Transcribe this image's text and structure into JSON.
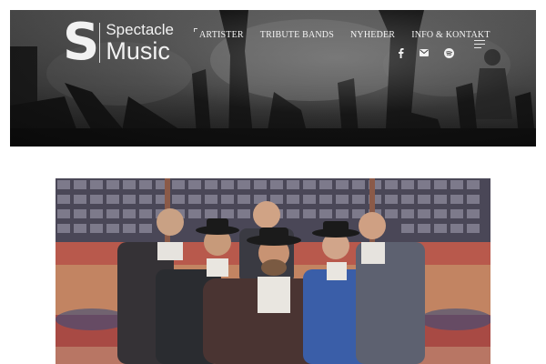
{
  "brand": {
    "logo_letter": "S",
    "line1": "Spectacle",
    "line2": "Music"
  },
  "nav": {
    "items": [
      {
        "label": "ARTISTER",
        "active": true
      },
      {
        "label": "TRIBUTE BANDS",
        "active": false
      },
      {
        "label": "NYHEDER",
        "active": false
      },
      {
        "label": "INFO & KONTAKT",
        "active": false
      }
    ]
  },
  "social": {
    "icons": [
      "facebook-icon",
      "email-icon",
      "spotify-icon"
    ]
  },
  "colors": {
    "header_dark": "#2f2f2f",
    "text_light": "#f4f4f4",
    "suit_blue": "#3a5ea8",
    "carpet_red": "#a6463f"
  }
}
